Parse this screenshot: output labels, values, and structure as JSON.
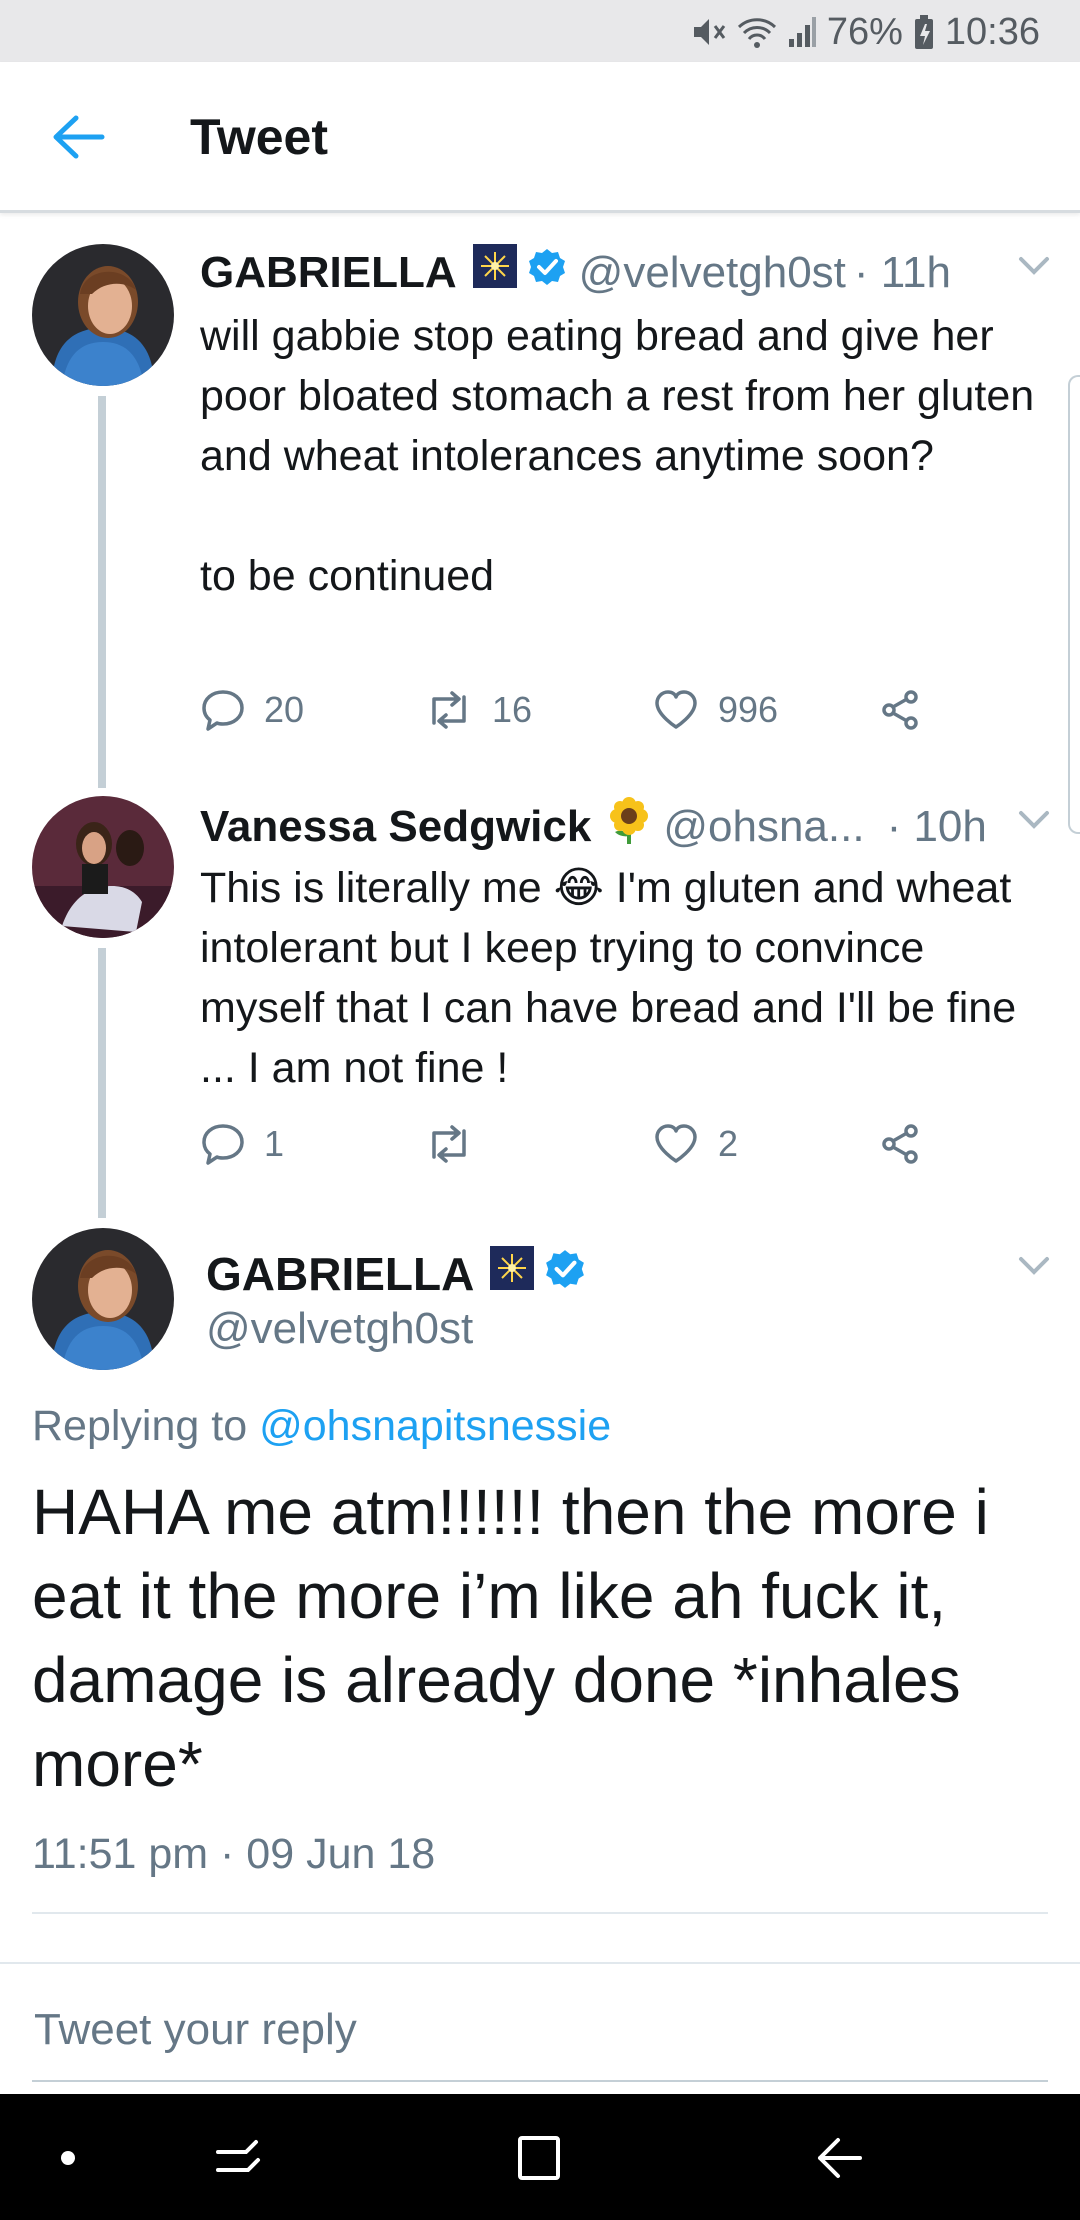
{
  "status_bar": {
    "battery": "76%",
    "time": "10:36"
  },
  "header": {
    "title": "Tweet"
  },
  "tweets": [
    {
      "name": "GABRIELLA",
      "handle": "@velvetgh0st",
      "time": "· 11h",
      "text": "will gabbie stop eating bread and give her poor bloated stomach a rest from her gluten and wheat intolerances anytime soon?\n\nto be continued",
      "replies": "20",
      "retweets": "16",
      "likes": "996"
    },
    {
      "name": "Vanessa Sedgwick",
      "handle": "@ohsna...",
      "time": "· 10h",
      "text": "This is literally me 😂 I'm gluten and wheat intolerant but I keep trying to convince myself that I can have bread and I'll be fine ... I am not fine !",
      "replies": "1",
      "retweets": "",
      "likes": "2"
    }
  ],
  "main_tweet": {
    "name": "GABRIELLA",
    "handle": "@velvetgh0st",
    "replying_prefix": "Replying to",
    "replying_to": "@ohsnapitsnessie",
    "text": "HAHA me atm!!!!!! then the more i eat it the more i’m like ah fuck it, damage is already done *inhales more*",
    "date": "11:51 pm · 09 Jun 18"
  },
  "reply_box": {
    "placeholder": "Tweet your reply"
  },
  "colors": {
    "accent": "#1da1f2",
    "secondary_text": "#657786",
    "thread_line": "#c4cfd6"
  },
  "icons": {
    "back": "arrow-left-icon",
    "verified": "verified-badge-icon",
    "reply": "comment-icon",
    "retweet": "retweet-icon",
    "like": "heart-icon",
    "share": "share-icon",
    "caret": "chevron-down-icon"
  }
}
